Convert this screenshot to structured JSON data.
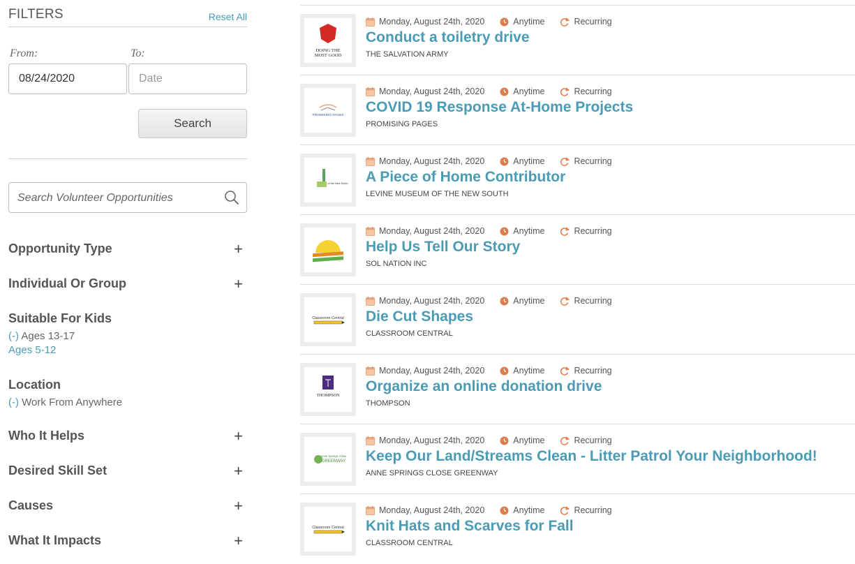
{
  "filters": {
    "title": "FILTERS",
    "reset_label": "Reset All",
    "from_label": "From:",
    "to_label": "To:",
    "from_value": "08/24/2020",
    "to_placeholder": "Date",
    "search_button": "Search",
    "search_placeholder": "Search Volunteer Opportunities",
    "facets": [
      {
        "title": "Opportunity Type",
        "expand": "+"
      },
      {
        "title": "Individual Or Group",
        "expand": "+"
      },
      {
        "title": "Suitable For Kids",
        "selected": "(-) Ages 13-17",
        "selected_prefix": "(-)",
        "selected_text": "Ages 13-17",
        "option": "Ages 5-12"
      },
      {
        "title": "Location",
        "selected_prefix": "(-)",
        "selected_text": "Work From Anywhere"
      },
      {
        "title": "Who It Helps",
        "expand": "+"
      },
      {
        "title": "Desired Skill Set",
        "expand": "+"
      },
      {
        "title": "Causes",
        "expand": "+"
      },
      {
        "title": "What It Impacts",
        "expand": "+"
      }
    ]
  },
  "colors": {
    "accent": "#4a9bb5",
    "calendar": "#e8a77a",
    "clock": "#e07b4c"
  },
  "opportunities": [
    {
      "date": "Monday, August 24th, 2020",
      "time": "Anytime",
      "recurrence": "Recurring",
      "title": "Conduct a toiletry drive",
      "org": "THE SALVATION ARMY",
      "logo_text": "DOING THE\nMOST GOOD"
    },
    {
      "date": "Monday, August 24th, 2020",
      "time": "Anytime",
      "recurrence": "Recurring",
      "title": "COVID 19 Response At-Home Projects",
      "org": "PROMISING PAGES",
      "logo_text": "PROMISING PAGES"
    },
    {
      "date": "Monday, August 24th, 2020",
      "time": "Anytime",
      "recurrence": "Recurring",
      "title": "A Piece of Home Contributor",
      "org": "LEVINE MUSEUM OF THE NEW SOUTH",
      "logo_text": "of the New South"
    },
    {
      "date": "Monday, August 24th, 2020",
      "time": "Anytime",
      "recurrence": "Recurring",
      "title": "Help Us Tell Our Story",
      "org": "SOL NATION INC",
      "logo_text": ""
    },
    {
      "date": "Monday, August 24th, 2020",
      "time": "Anytime",
      "recurrence": "Recurring",
      "title": "Die Cut Shapes",
      "org": "CLASSROOM CENTRAL",
      "logo_text": "Classroom Central"
    },
    {
      "date": "Monday, August 24th, 2020",
      "time": "Anytime",
      "recurrence": "Recurring",
      "title": "Organize an online donation drive",
      "org": "THOMPSON",
      "logo_text": "THOMPSON"
    },
    {
      "date": "Monday, August 24th, 2020",
      "time": "Anytime",
      "recurrence": "Recurring",
      "title": "Keep Our Land/Streams Clean - Litter Patrol Your Neighborhood!",
      "org": "ANNE SPRINGS CLOSE GREENWAY",
      "logo_text": "Anne Springs Close\nGREENWAY"
    },
    {
      "date": "Monday, August 24th, 2020",
      "time": "Anytime",
      "recurrence": "Recurring",
      "title": "Knit Hats and Scarves for Fall",
      "org": "CLASSROOM CENTRAL",
      "logo_text": "Classroom Central"
    }
  ]
}
